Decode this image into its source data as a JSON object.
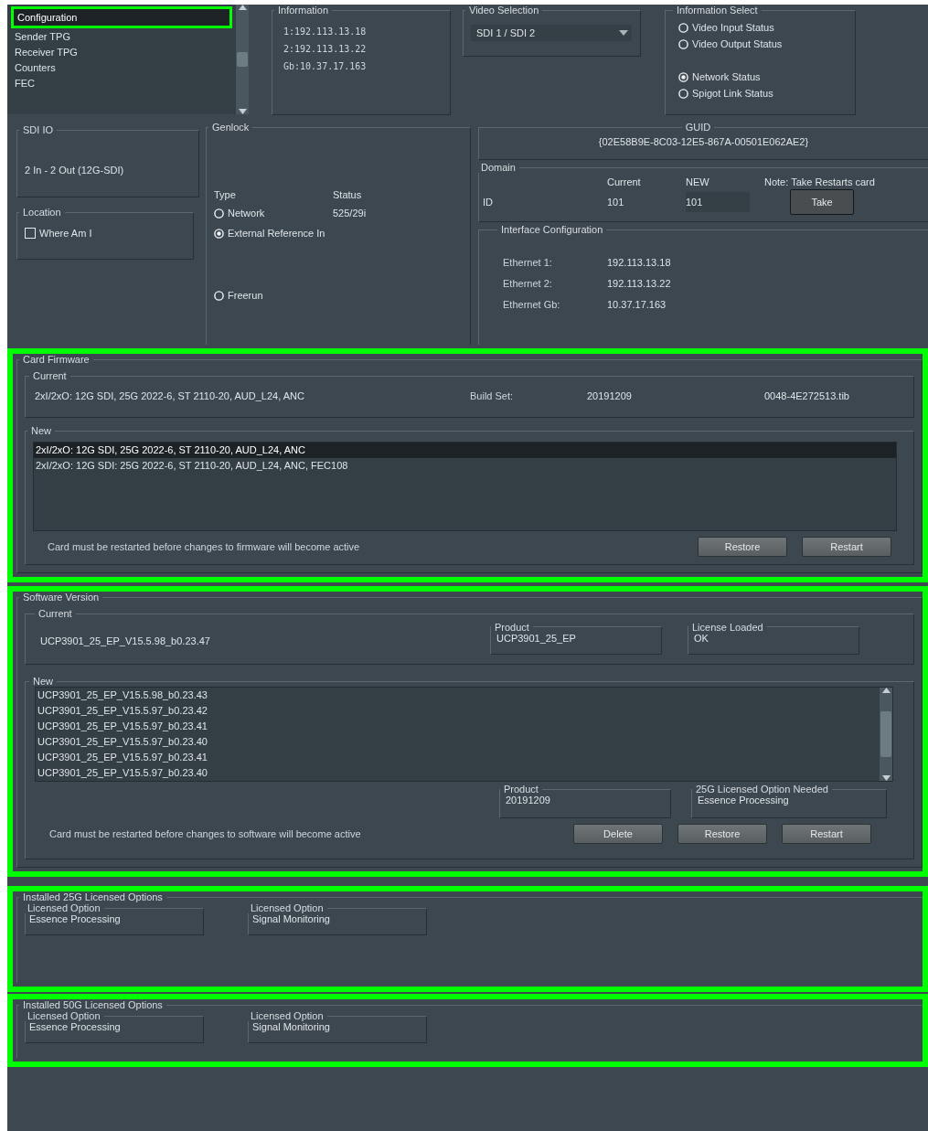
{
  "sidebar": {
    "items": [
      {
        "label": "Configuration",
        "selected": true,
        "highlighted": true
      },
      {
        "label": "Sender TPG",
        "selected": false,
        "highlighted": false
      },
      {
        "label": "Receiver TPG",
        "selected": false,
        "highlighted": false
      },
      {
        "label": "Counters",
        "selected": false,
        "highlighted": false
      },
      {
        "label": "FEC",
        "selected": false,
        "highlighted": false
      }
    ]
  },
  "information": {
    "title": "Information",
    "lines": [
      "1:192.113.13.18",
      "2:192.113.13.22",
      "Gb:10.37.17.163"
    ]
  },
  "video_selection": {
    "title": "Video Selection",
    "value": "SDI 1 / SDI 2"
  },
  "information_select": {
    "title": "Information Select",
    "options": [
      {
        "label": "Video Input Status",
        "selected": false
      },
      {
        "label": "Video Output Status",
        "selected": false
      },
      {
        "label": "Network Status",
        "selected": true
      },
      {
        "label": "Spigot Link Status",
        "selected": false
      }
    ]
  },
  "sdi_io": {
    "title": "SDI IO",
    "value": "2 In - 2 Out (12G-SDI)"
  },
  "location": {
    "title": "Location",
    "checkbox": {
      "label": "Where Am I",
      "checked": false
    }
  },
  "genlock": {
    "title": "Genlock",
    "columns": [
      "Type",
      "Status"
    ],
    "options": [
      {
        "label": "Network",
        "selected": false,
        "status": "525/29i"
      },
      {
        "label": "External Reference In",
        "selected": true
      },
      {
        "label": "Freerun",
        "selected": false
      }
    ]
  },
  "guid": {
    "title": "GUID",
    "value": "{02E58B9E-8C03-12E5-867A-00501E062AE2}"
  },
  "domain": {
    "title": "Domain",
    "columns": [
      "Current",
      "NEW"
    ],
    "note": "Note: Take Restarts card",
    "row_label": "ID",
    "current": "101",
    "new_value": "101",
    "button": "Take"
  },
  "interface_configuration": {
    "title": "Interface Configuration",
    "rows": [
      {
        "label": "Ethernet 1:",
        "value": "192.113.13.18"
      },
      {
        "label": "Ethernet 2:",
        "value": "192.113.13.22"
      },
      {
        "label": "Ethernet Gb:",
        "value": "10.37.17.163"
      }
    ]
  },
  "card_firmware": {
    "title": "Card Firmware",
    "highlighted": true,
    "current": {
      "title": "Current",
      "description": "2xI/2xO: 12G SDI, 25G 2022-6, ST 2110-20, AUD_L24, ANC",
      "build_set_label": "Build Set:",
      "build_set": "20191209",
      "file": "0048-4E272513.tib"
    },
    "new": {
      "title": "New",
      "items": [
        {
          "label": "2xI/2xO: 12G SDI, 25G 2022-6, ST 2110-20, AUD_L24, ANC",
          "selected": true
        },
        {
          "label": "2xI/2xO: 12G SDI: 25G 2022-6, ST 2110-20, AUD_L24, ANC, FEC108",
          "selected": false
        }
      ]
    },
    "note": "Card must be restarted before changes to firmware will become active",
    "buttons": [
      "Restore",
      "Restart"
    ]
  },
  "software_version": {
    "title": "Software Version",
    "highlighted": true,
    "current": {
      "title": "Current",
      "value": "UCP3901_25_EP_V15.5.98_b0.23.47",
      "product": {
        "title": "Product",
        "value": "UCP3901_25_EP"
      },
      "license": {
        "title": "License Loaded",
        "value": "OK"
      }
    },
    "new": {
      "title": "New",
      "items": [
        {
          "label": "UCP3901_25_EP_V15.5.98_b0.23.43",
          "selected": false
        },
        {
          "label": "UCP3901_25_EP_V15.5.97_b0.23.42",
          "selected": false
        },
        {
          "label": "UCP3901_25_EP_V15.5.97_b0.23.41",
          "selected": false
        },
        {
          "label": "UCP3901_25_EP_V15.5.97_b0.23.40",
          "selected": false
        },
        {
          "label": "UCP3901_25_EP_V15.5.97_b0.23.41",
          "selected": false
        },
        {
          "label": "UCP3901_25_EP_V15.5.97_b0.23.40",
          "selected": false
        }
      ],
      "product": {
        "title": "Product",
        "value": "20191209"
      },
      "option_needed": {
        "title": "25G Licensed Option Needed",
        "value": "Essence Processing"
      }
    },
    "note": "Card must be restarted before changes to software will become active",
    "buttons": [
      "Delete",
      "Restore",
      "Restart"
    ]
  },
  "licensed_options": [
    {
      "title": "Installed 25G Licensed Options",
      "highlighted": true,
      "options": [
        {
          "title": "Licensed Option",
          "value": "Essence Processing"
        },
        {
          "title": "Licensed Option",
          "value": "Signal Monitoring"
        }
      ]
    },
    {
      "title": "Installed 50G Licensed Options",
      "highlighted": true,
      "options": [
        {
          "title": "Licensed Option",
          "value": "Essence Processing"
        },
        {
          "title": "Licensed Option",
          "value": "Signal Monitoring"
        }
      ]
    }
  ]
}
